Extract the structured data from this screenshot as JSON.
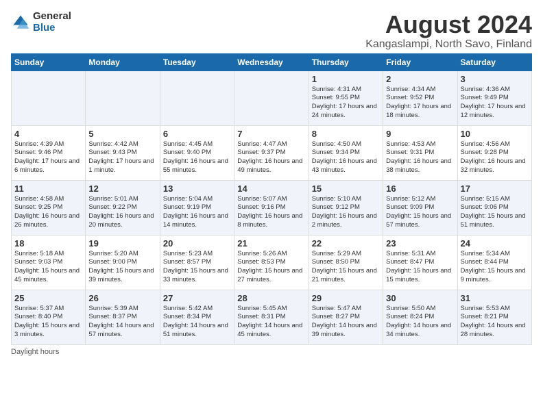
{
  "logo": {
    "general": "General",
    "blue": "Blue"
  },
  "title": "August 2024",
  "subtitle": "Kangaslampi, North Savo, Finland",
  "weekdays": [
    "Sunday",
    "Monday",
    "Tuesday",
    "Wednesday",
    "Thursday",
    "Friday",
    "Saturday"
  ],
  "weeks": [
    [
      {
        "day": "",
        "info": ""
      },
      {
        "day": "",
        "info": ""
      },
      {
        "day": "",
        "info": ""
      },
      {
        "day": "",
        "info": ""
      },
      {
        "day": "1",
        "info": "Sunrise: 4:31 AM\nSunset: 9:55 PM\nDaylight: 17 hours\nand 24 minutes."
      },
      {
        "day": "2",
        "info": "Sunrise: 4:34 AM\nSunset: 9:52 PM\nDaylight: 17 hours\nand 18 minutes."
      },
      {
        "day": "3",
        "info": "Sunrise: 4:36 AM\nSunset: 9:49 PM\nDaylight: 17 hours\nand 12 minutes."
      }
    ],
    [
      {
        "day": "4",
        "info": "Sunrise: 4:39 AM\nSunset: 9:46 PM\nDaylight: 17 hours\nand 6 minutes."
      },
      {
        "day": "5",
        "info": "Sunrise: 4:42 AM\nSunset: 9:43 PM\nDaylight: 17 hours\nand 1 minute."
      },
      {
        "day": "6",
        "info": "Sunrise: 4:45 AM\nSunset: 9:40 PM\nDaylight: 16 hours\nand 55 minutes."
      },
      {
        "day": "7",
        "info": "Sunrise: 4:47 AM\nSunset: 9:37 PM\nDaylight: 16 hours\nand 49 minutes."
      },
      {
        "day": "8",
        "info": "Sunrise: 4:50 AM\nSunset: 9:34 PM\nDaylight: 16 hours\nand 43 minutes."
      },
      {
        "day": "9",
        "info": "Sunrise: 4:53 AM\nSunset: 9:31 PM\nDaylight: 16 hours\nand 38 minutes."
      },
      {
        "day": "10",
        "info": "Sunrise: 4:56 AM\nSunset: 9:28 PM\nDaylight: 16 hours\nand 32 minutes."
      }
    ],
    [
      {
        "day": "11",
        "info": "Sunrise: 4:58 AM\nSunset: 9:25 PM\nDaylight: 16 hours\nand 26 minutes."
      },
      {
        "day": "12",
        "info": "Sunrise: 5:01 AM\nSunset: 9:22 PM\nDaylight: 16 hours\nand 20 minutes."
      },
      {
        "day": "13",
        "info": "Sunrise: 5:04 AM\nSunset: 9:19 PM\nDaylight: 16 hours\nand 14 minutes."
      },
      {
        "day": "14",
        "info": "Sunrise: 5:07 AM\nSunset: 9:16 PM\nDaylight: 16 hours\nand 8 minutes."
      },
      {
        "day": "15",
        "info": "Sunrise: 5:10 AM\nSunset: 9:12 PM\nDaylight: 16 hours\nand 2 minutes."
      },
      {
        "day": "16",
        "info": "Sunrise: 5:12 AM\nSunset: 9:09 PM\nDaylight: 15 hours\nand 57 minutes."
      },
      {
        "day": "17",
        "info": "Sunrise: 5:15 AM\nSunset: 9:06 PM\nDaylight: 15 hours\nand 51 minutes."
      }
    ],
    [
      {
        "day": "18",
        "info": "Sunrise: 5:18 AM\nSunset: 9:03 PM\nDaylight: 15 hours\nand 45 minutes."
      },
      {
        "day": "19",
        "info": "Sunrise: 5:20 AM\nSunset: 9:00 PM\nDaylight: 15 hours\nand 39 minutes."
      },
      {
        "day": "20",
        "info": "Sunrise: 5:23 AM\nSunset: 8:57 PM\nDaylight: 15 hours\nand 33 minutes."
      },
      {
        "day": "21",
        "info": "Sunrise: 5:26 AM\nSunset: 8:53 PM\nDaylight: 15 hours\nand 27 minutes."
      },
      {
        "day": "22",
        "info": "Sunrise: 5:29 AM\nSunset: 8:50 PM\nDaylight: 15 hours\nand 21 minutes."
      },
      {
        "day": "23",
        "info": "Sunrise: 5:31 AM\nSunset: 8:47 PM\nDaylight: 15 hours\nand 15 minutes."
      },
      {
        "day": "24",
        "info": "Sunrise: 5:34 AM\nSunset: 8:44 PM\nDaylight: 15 hours\nand 9 minutes."
      }
    ],
    [
      {
        "day": "25",
        "info": "Sunrise: 5:37 AM\nSunset: 8:40 PM\nDaylight: 15 hours\nand 3 minutes."
      },
      {
        "day": "26",
        "info": "Sunrise: 5:39 AM\nSunset: 8:37 PM\nDaylight: 14 hours\nand 57 minutes."
      },
      {
        "day": "27",
        "info": "Sunrise: 5:42 AM\nSunset: 8:34 PM\nDaylight: 14 hours\nand 51 minutes."
      },
      {
        "day": "28",
        "info": "Sunrise: 5:45 AM\nSunset: 8:31 PM\nDaylight: 14 hours\nand 45 minutes."
      },
      {
        "day": "29",
        "info": "Sunrise: 5:47 AM\nSunset: 8:27 PM\nDaylight: 14 hours\nand 39 minutes."
      },
      {
        "day": "30",
        "info": "Sunrise: 5:50 AM\nSunset: 8:24 PM\nDaylight: 14 hours\nand 34 minutes."
      },
      {
        "day": "31",
        "info": "Sunrise: 5:53 AM\nSunset: 8:21 PM\nDaylight: 14 hours\nand 28 minutes."
      }
    ]
  ],
  "footer": "Daylight hours"
}
